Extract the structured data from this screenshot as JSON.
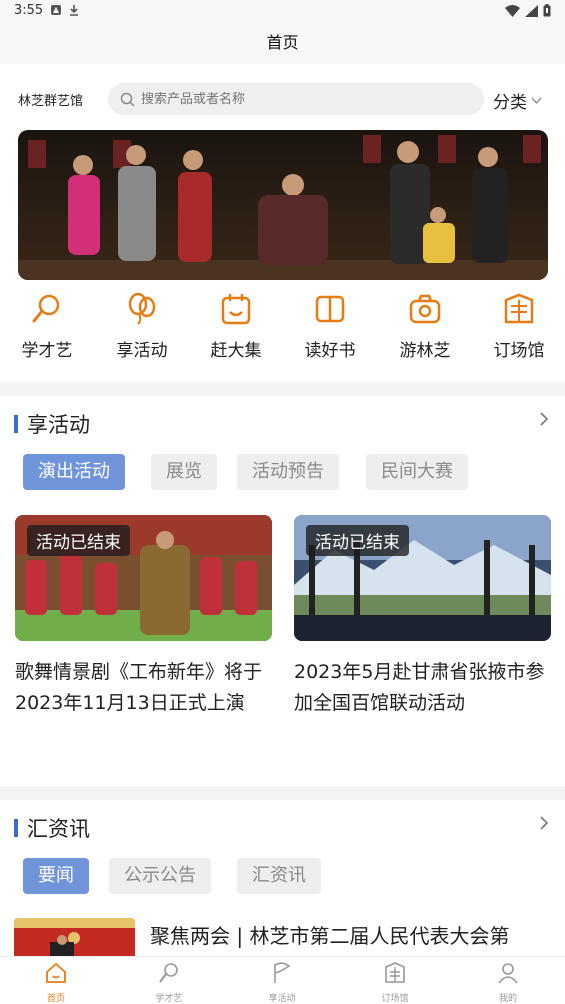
{
  "status": {
    "time": "3:55"
  },
  "header": {
    "title": "首页"
  },
  "top": {
    "brand": "林芝群艺馆",
    "search_placeholder": "搜索产品或者名称",
    "category_label": "分类"
  },
  "quick": [
    {
      "label": "学才艺",
      "icon": "microphone-icon"
    },
    {
      "label": "享活动",
      "icon": "balloon-icon"
    },
    {
      "label": "赶大集",
      "icon": "market-bag-icon"
    },
    {
      "label": "读好书",
      "icon": "book-icon"
    },
    {
      "label": "游林芝",
      "icon": "camera-icon"
    },
    {
      "label": "订场馆",
      "icon": "venue-icon"
    }
  ],
  "activities": {
    "title": "享活动",
    "tabs": [
      "演出活动",
      "展览",
      "活动预告",
      "民间大赛"
    ],
    "active_tab": 0,
    "cards": [
      {
        "badge": "活动已结束",
        "title": "歌舞情景剧《工布新年》将于2023年11月13日正式上演"
      },
      {
        "badge": "活动已结束",
        "title": "2023年5月赴甘肃省张掖市参加全国百馆联动活动"
      }
    ]
  },
  "news": {
    "title": "汇资讯",
    "tabs": [
      "要闻",
      "公示公告",
      "汇资讯"
    ],
    "active_tab": 0,
    "items": [
      {
        "title": "聚焦两会 | 林芝市第二届人民代表大会第"
      }
    ]
  },
  "tabbar": [
    {
      "label": "首页",
      "icon": "home-icon",
      "active": true
    },
    {
      "label": "学才艺",
      "icon": "microphone-icon",
      "active": false
    },
    {
      "label": "享活动",
      "icon": "flag-icon",
      "active": false
    },
    {
      "label": "订场馆",
      "icon": "venue-icon",
      "active": false
    },
    {
      "label": "我的",
      "icon": "user-icon",
      "active": false
    }
  ],
  "colors": {
    "accent": "#e57c14",
    "brand_blue": "#3d6bd8",
    "active_pill": "#6f94d9"
  }
}
